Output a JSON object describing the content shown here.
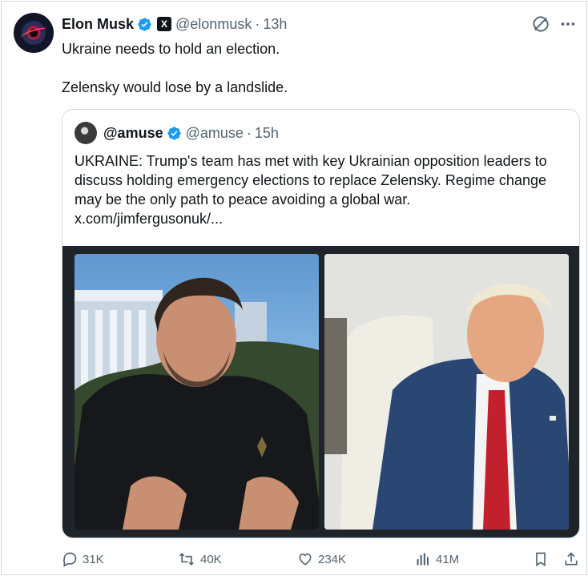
{
  "author": {
    "name": "Elon Musk",
    "handle": "@elonmusk",
    "separator": "·",
    "time": "13h",
    "badge_letter": "X"
  },
  "tweet": {
    "lines": [
      "Ukraine needs to hold an election.",
      "Zelensky would lose by a landslide."
    ]
  },
  "quoted": {
    "name": "@amuse",
    "handle": "@amuse",
    "separator": "·",
    "time": "15h",
    "text": "UKRAINE: Trump's team has met with key Ukrainian opposition leaders to discuss holding emergency elections to replace Zelensky. Regime change may be the only path to peace avoiding a global war.",
    "link": "x.com/jimfergusonuk/..."
  },
  "actions": {
    "replies": "31K",
    "reposts": "40K",
    "likes": "234K",
    "views": "41M"
  },
  "colors": {
    "verified": "#1d9bf0",
    "text": "#0f1419",
    "muted": "#536471",
    "border": "#cfd9de"
  },
  "icons": [
    "verified-badge-icon",
    "x-affiliate-icon",
    "grok-icon",
    "more-icon",
    "reply-icon",
    "repost-icon",
    "like-icon",
    "views-icon",
    "bookmark-icon",
    "share-icon"
  ]
}
